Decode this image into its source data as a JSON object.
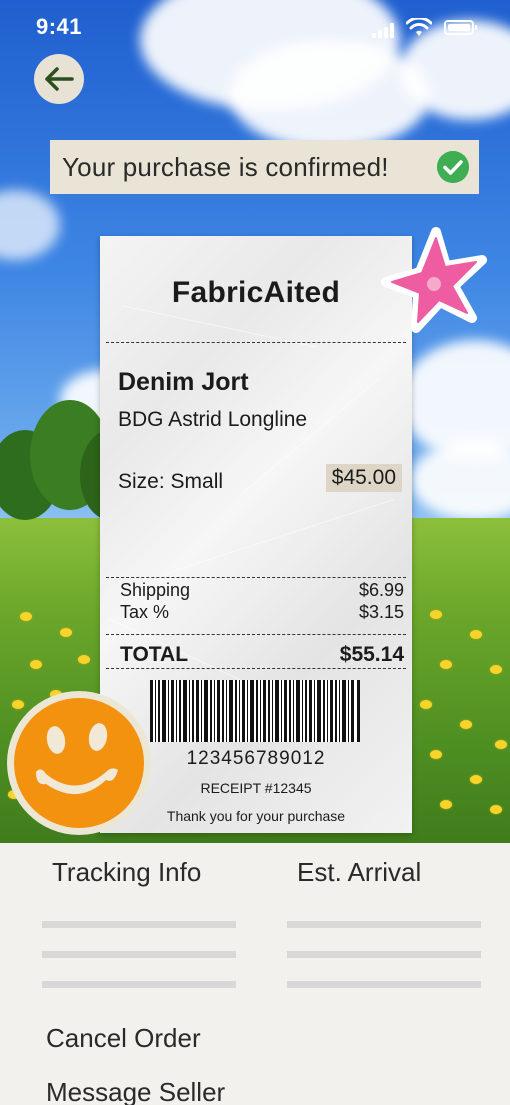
{
  "status_bar": {
    "time": "9:41"
  },
  "banner": {
    "text": "Your purchase is confirmed!"
  },
  "receipt": {
    "store": "FabricAited",
    "item_name": "Denim Jort",
    "item_description": "BDG Astrid Longline",
    "size": "Size: Small",
    "price": "$45.00",
    "lines": [
      {
        "label": "Shipping",
        "value": "$6.99"
      },
      {
        "label": "Tax %",
        "value": "$3.15"
      }
    ],
    "total_label": "TOTAL",
    "total_value": "$55.14",
    "barcode_number": "123456789012",
    "receipt_number": "RECEIPT #12345",
    "thank_you": "Thank you for your purchase"
  },
  "sheet": {
    "tracking_title": "Tracking Info",
    "arrival_title": "Est. Arrival",
    "actions": [
      "Cancel Order",
      "Message Seller"
    ]
  },
  "colors": {
    "banner_bg": "#e9e4d6",
    "check_green": "#3fae52",
    "sticker_pink": "#ee5da1",
    "smiley_orange": "#f3920f",
    "sheet_bg": "#f2f1ee"
  }
}
